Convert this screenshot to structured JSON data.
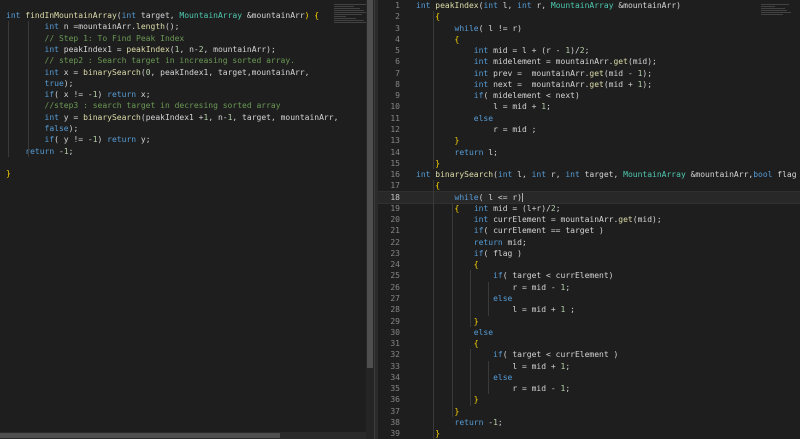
{
  "left_editor": {
    "lines": [
      [
        [
          "int ",
          "kw"
        ],
        [
          "findInMountainArray",
          "fn"
        ],
        [
          "(",
          ""
        ],
        [
          "int",
          "kw"
        ],
        [
          " target, ",
          ""
        ],
        [
          "MountainArray",
          "ty"
        ],
        [
          " &mountainArr",
          ""
        ],
        [
          ") {",
          "br"
        ]
      ],
      [
        [
          "        ",
          ""
        ],
        [
          "int",
          "kw"
        ],
        [
          " n =mountainArr.",
          ""
        ],
        [
          "length",
          "fn"
        ],
        [
          "();",
          ""
        ]
      ],
      [
        [
          "        ",
          ""
        ],
        [
          "// Step 1: To Find Peak Index",
          "cm"
        ]
      ],
      [
        [
          "        ",
          ""
        ],
        [
          "int",
          "kw"
        ],
        [
          " peakIndex1 = ",
          ""
        ],
        [
          "peakIndex",
          "fn"
        ],
        [
          "(",
          ""
        ],
        [
          "1",
          "num"
        ],
        [
          ", n-",
          ""
        ],
        [
          "2",
          "num"
        ],
        [
          ", mountainArr);",
          ""
        ]
      ],
      [
        [
          "        ",
          ""
        ],
        [
          "// step2 : Search target in increasing sorted array.",
          "cm"
        ]
      ],
      [
        [
          "        ",
          ""
        ],
        [
          "int",
          "kw"
        ],
        [
          " x = ",
          ""
        ],
        [
          "binarySearch",
          "fn"
        ],
        [
          "(",
          ""
        ],
        [
          "0",
          "num"
        ],
        [
          ", peakIndex1, target,mountainArr,",
          ""
        ]
      ],
      [
        [
          "        ",
          ""
        ],
        [
          "true",
          "kw"
        ],
        [
          ");",
          ""
        ]
      ],
      [
        [
          "        ",
          ""
        ],
        [
          "if",
          "kw"
        ],
        [
          "( x != -",
          ""
        ],
        [
          "1",
          "num"
        ],
        [
          ") ",
          ""
        ],
        [
          "return",
          "kw"
        ],
        [
          " x;",
          ""
        ]
      ],
      [
        [
          "        ",
          ""
        ],
        [
          "//step3 : search target in decresing sorted array",
          "cm"
        ]
      ],
      [
        [
          "        ",
          ""
        ],
        [
          "int",
          "kw"
        ],
        [
          " y = ",
          ""
        ],
        [
          "binarySearch",
          "fn"
        ],
        [
          "(peakIndex1 +",
          ""
        ],
        [
          "1",
          "num"
        ],
        [
          ", n-",
          ""
        ],
        [
          "1",
          "num"
        ],
        [
          ", target, mountainArr,",
          ""
        ]
      ],
      [
        [
          "        ",
          ""
        ],
        [
          "false",
          "kw"
        ],
        [
          ");",
          ""
        ]
      ],
      [
        [
          "        ",
          ""
        ],
        [
          "if",
          "kw"
        ],
        [
          "( y != -",
          ""
        ],
        [
          "1",
          "num"
        ],
        [
          ") ",
          ""
        ],
        [
          "return",
          "kw"
        ],
        [
          " y;",
          ""
        ]
      ],
      [
        [
          "    ",
          ""
        ],
        [
          "return",
          "kw"
        ],
        [
          " -",
          ""
        ],
        [
          "1",
          "num"
        ],
        [
          ";",
          ""
        ]
      ],
      [
        [
          "",
          ""
        ]
      ],
      [
        [
          "}",
          "br"
        ]
      ]
    ]
  },
  "right_editor": {
    "active_line": 18,
    "lines": [
      {
        "n": "1",
        "t": [
          [
            "int ",
            "kw"
          ],
          [
            "peakIndex",
            "fn"
          ],
          [
            "(",
            ""
          ],
          [
            "int",
            "kw"
          ],
          [
            " l, ",
            ""
          ],
          [
            "int",
            "kw"
          ],
          [
            " r, ",
            ""
          ],
          [
            "MountainArray",
            "ty"
          ],
          [
            " &mountainArr)",
            ""
          ]
        ]
      },
      {
        "n": "2",
        "t": [
          [
            "    {",
            "br"
          ]
        ]
      },
      {
        "n": "3",
        "t": [
          [
            "        ",
            ""
          ],
          [
            "while",
            "kw"
          ],
          [
            "( l != r)",
            ""
          ]
        ]
      },
      {
        "n": "4",
        "t": [
          [
            "        {",
            "br"
          ]
        ]
      },
      {
        "n": "5",
        "t": [
          [
            "            ",
            ""
          ],
          [
            "int",
            "kw"
          ],
          [
            " mid = l + (r - ",
            ""
          ],
          [
            "1",
            "num"
          ],
          [
            ")/",
            ""
          ],
          [
            "2",
            "num"
          ],
          [
            ";",
            ""
          ]
        ]
      },
      {
        "n": "6",
        "t": [
          [
            "            ",
            ""
          ],
          [
            "int",
            "kw"
          ],
          [
            " midelement = mountainArr.",
            ""
          ],
          [
            "get",
            "fn"
          ],
          [
            "(mid);",
            ""
          ]
        ]
      },
      {
        "n": "7",
        "t": [
          [
            "            ",
            ""
          ],
          [
            "int",
            "kw"
          ],
          [
            " prev =  mountainArr.",
            ""
          ],
          [
            "get",
            "fn"
          ],
          [
            "(mid - ",
            ""
          ],
          [
            "1",
            "num"
          ],
          [
            ");",
            ""
          ]
        ]
      },
      {
        "n": "8",
        "t": [
          [
            "            ",
            ""
          ],
          [
            "int",
            "kw"
          ],
          [
            " next =  mountainArr.",
            ""
          ],
          [
            "get",
            "fn"
          ],
          [
            "(mid + ",
            ""
          ],
          [
            "1",
            "num"
          ],
          [
            ");",
            ""
          ]
        ]
      },
      {
        "n": "9",
        "t": [
          [
            "            ",
            ""
          ],
          [
            "if",
            "kw"
          ],
          [
            "( midelement < next)",
            ""
          ]
        ]
      },
      {
        "n": "10",
        "t": [
          [
            "                l = mid + ",
            ""
          ],
          [
            "1",
            "num"
          ],
          [
            ";",
            ""
          ]
        ]
      },
      {
        "n": "11",
        "t": [
          [
            "            ",
            ""
          ],
          [
            "else",
            "kw"
          ]
        ]
      },
      {
        "n": "12",
        "t": [
          [
            "                r = mid ;",
            ""
          ]
        ]
      },
      {
        "n": "13",
        "t": [
          [
            "        }",
            "br"
          ]
        ]
      },
      {
        "n": "14",
        "t": [
          [
            "        ",
            ""
          ],
          [
            "return",
            "kw"
          ],
          [
            " l;",
            ""
          ]
        ]
      },
      {
        "n": "15",
        "t": [
          [
            "    }",
            "br"
          ]
        ]
      },
      {
        "n": "16",
        "t": [
          [
            "int ",
            "kw"
          ],
          [
            "binarySearch",
            "fn"
          ],
          [
            "(",
            ""
          ],
          [
            "int",
            "kw"
          ],
          [
            " l, ",
            ""
          ],
          [
            "int",
            "kw"
          ],
          [
            " r, ",
            ""
          ],
          [
            "int",
            "kw"
          ],
          [
            " target, ",
            ""
          ],
          [
            "MountainArray",
            "ty"
          ],
          [
            " &mountainArr,",
            ""
          ],
          [
            "bool",
            "kw"
          ],
          [
            " flag",
            ""
          ]
        ]
      },
      {
        "n": "17",
        "t": [
          [
            "    {",
            "br"
          ]
        ]
      },
      {
        "n": "18",
        "t": [
          [
            "        ",
            ""
          ],
          [
            "while",
            "kw"
          ],
          [
            "( l <= r)",
            ""
          ]
        ]
      },
      {
        "n": "19",
        "t": [
          [
            "        {",
            "br"
          ],
          [
            "   ",
            ""
          ],
          [
            "int",
            "kw"
          ],
          [
            " mid = (l+r)/",
            ""
          ],
          [
            "2",
            "num"
          ],
          [
            ";",
            ""
          ]
        ]
      },
      {
        "n": "20",
        "t": [
          [
            "            ",
            ""
          ],
          [
            "int",
            "kw"
          ],
          [
            " currElement = mountainArr.",
            ""
          ],
          [
            "get",
            "fn"
          ],
          [
            "(mid);",
            ""
          ]
        ]
      },
      {
        "n": "21",
        "t": [
          [
            "            ",
            ""
          ],
          [
            "if",
            "kw"
          ],
          [
            "( currElement == target )",
            ""
          ]
        ]
      },
      {
        "n": "22",
        "t": [
          [
            "            ",
            ""
          ],
          [
            "return",
            "kw"
          ],
          [
            " mid;",
            ""
          ]
        ]
      },
      {
        "n": "23",
        "t": [
          [
            "            ",
            ""
          ],
          [
            "if",
            "kw"
          ],
          [
            "( flag )",
            ""
          ]
        ]
      },
      {
        "n": "24",
        "t": [
          [
            "            {",
            "br"
          ]
        ]
      },
      {
        "n": "25",
        "t": [
          [
            "                ",
            ""
          ],
          [
            "if",
            "kw"
          ],
          [
            "( target < currElement)",
            ""
          ]
        ]
      },
      {
        "n": "26",
        "t": [
          [
            "                    r = mid - ",
            ""
          ],
          [
            "1",
            "num"
          ],
          [
            ";",
            ""
          ]
        ]
      },
      {
        "n": "27",
        "t": [
          [
            "                ",
            ""
          ],
          [
            "else",
            "kw"
          ]
        ]
      },
      {
        "n": "28",
        "t": [
          [
            "                    l = mid + ",
            ""
          ],
          [
            "1",
            "num"
          ],
          [
            " ;",
            ""
          ]
        ]
      },
      {
        "n": "29",
        "t": [
          [
            "            }",
            "br"
          ]
        ]
      },
      {
        "n": "30",
        "t": [
          [
            "            ",
            ""
          ],
          [
            "else",
            "kw"
          ]
        ]
      },
      {
        "n": "31",
        "t": [
          [
            "            {",
            "br"
          ]
        ]
      },
      {
        "n": "32",
        "t": [
          [
            "                ",
            ""
          ],
          [
            "if",
            "kw"
          ],
          [
            "( target < currElement )",
            ""
          ]
        ]
      },
      {
        "n": "33",
        "t": [
          [
            "                    l = mid + ",
            ""
          ],
          [
            "1",
            "num"
          ],
          [
            ";",
            ""
          ]
        ]
      },
      {
        "n": "34",
        "t": [
          [
            "                ",
            ""
          ],
          [
            "else",
            "kw"
          ]
        ]
      },
      {
        "n": "35",
        "t": [
          [
            "                    r = mid - ",
            ""
          ],
          [
            "1",
            "num"
          ],
          [
            ";",
            ""
          ]
        ]
      },
      {
        "n": "36",
        "t": [
          [
            "            }",
            "br"
          ]
        ]
      },
      {
        "n": "37",
        "t": [
          [
            "        }",
            "br"
          ]
        ]
      },
      {
        "n": "38",
        "t": [
          [
            "        ",
            ""
          ],
          [
            "return",
            "kw"
          ],
          [
            " -",
            ""
          ],
          [
            "1",
            "num"
          ],
          [
            ";",
            ""
          ]
        ]
      },
      {
        "n": "39",
        "t": [
          [
            "    }",
            "br"
          ]
        ]
      }
    ]
  }
}
